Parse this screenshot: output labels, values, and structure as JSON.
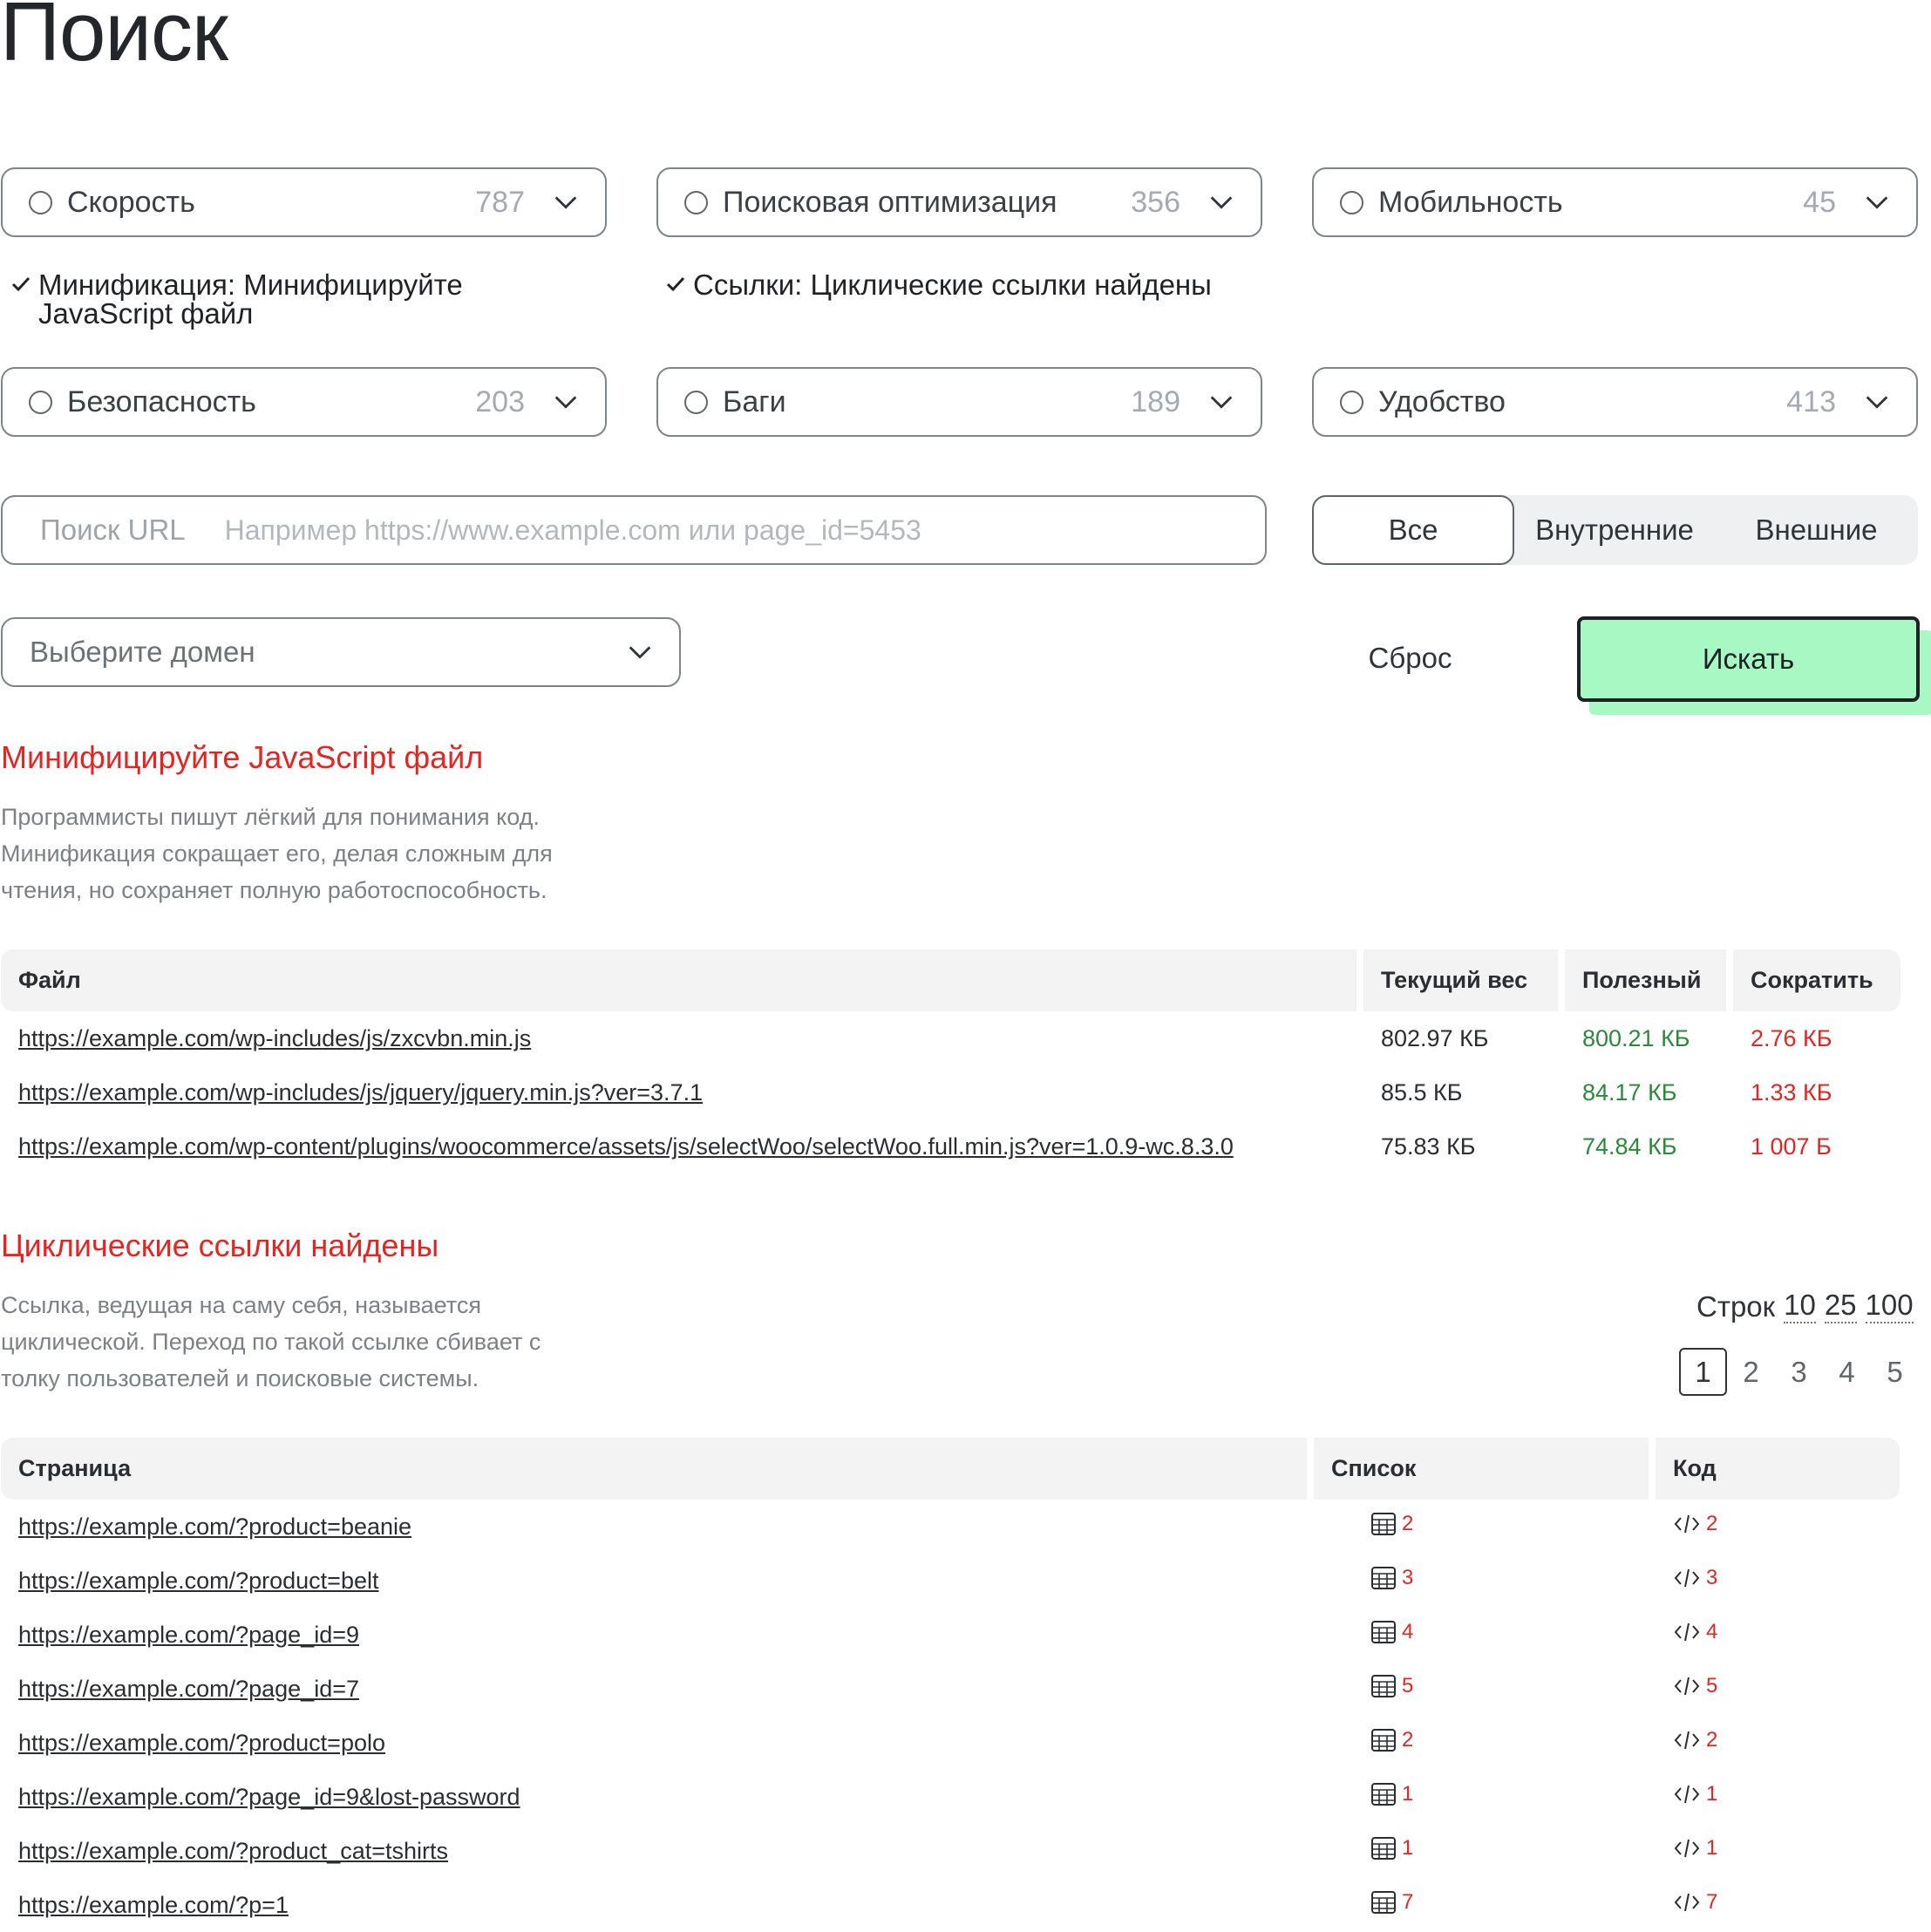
{
  "page": {
    "title": "Поиск"
  },
  "filters": [
    {
      "label": "Скорость",
      "count": "787"
    },
    {
      "label": "Поисковая оптимизация",
      "count": "356"
    },
    {
      "label": "Мобильность",
      "count": "45"
    },
    {
      "label": "Безопасность",
      "count": "203"
    },
    {
      "label": "Баги",
      "count": "189"
    },
    {
      "label": "Удобство",
      "count": "413"
    }
  ],
  "selected": [
    {
      "line1": "Минификация: Минифицируйте",
      "line2": "JavaScript файл"
    },
    {
      "line1": "Ссылки: Циклические ссылки найдены",
      "line2": ""
    }
  ],
  "url_search": {
    "label": "Поиск URL",
    "placeholder": "Например https://www.example.com или page_id=5453"
  },
  "link_type": {
    "options": [
      "Все",
      "Внутренние",
      "Внешние"
    ],
    "selected": "Все"
  },
  "domain_select": {
    "placeholder": "Выберите домен"
  },
  "actions": {
    "reset": "Сброс",
    "search": "Искать"
  },
  "colors": {
    "accent_red": "#e52521",
    "useful_green": "#2a8a3a",
    "search_button": "#a8f8c4"
  },
  "minify": {
    "title": "Минифицируйте JavaScript файл",
    "desc": [
      "Программисты пишут лёгкий для понимания код.",
      "Минификация сокращает его, делая сложным для",
      "чтения, но сохраняет полную работоспособность."
    ],
    "columns": [
      "Файл",
      "Текущий вес",
      "Полезный",
      "Сократить"
    ],
    "rows": [
      {
        "file": "https://example.com/wp-includes/js/zxcvbn.min.js",
        "weight": "802.97 КБ",
        "useful": "800.21 КБ",
        "reduce": "2.76 КБ"
      },
      {
        "file": "https://example.com/wp-includes/js/jquery/jquery.min.js?ver=3.7.1",
        "weight": "85.5 КБ",
        "useful": "84.17 КБ",
        "reduce": "1.33 КБ"
      },
      {
        "file": "https://example.com/wp-content/plugins/woocommerce/assets/js/selectWoo/selectWoo.full.min.js?ver=1.0.9-wc.8.3.0",
        "weight": "75.83 КБ",
        "useful": "74.84 КБ",
        "reduce": "1 007 Б"
      }
    ]
  },
  "cyclic": {
    "title": "Циклические ссылки найдены",
    "desc": [
      "Ссылка, ведущая на саму себя, называется",
      "циклической. Переход по такой ссылке сбивает с",
      "толку пользователей и поисковые системы."
    ],
    "rows_label": "Строк",
    "rows_options": [
      "10",
      "25",
      "100"
    ],
    "pages": [
      "1",
      "2",
      "3",
      "4",
      "5"
    ],
    "current_page": "1",
    "columns": [
      "Страница",
      "Список",
      "Код"
    ],
    "rows": [
      {
        "page": "https://example.com/?product=beanie",
        "list": "2",
        "code": "2"
      },
      {
        "page": "https://example.com/?product=belt",
        "list": "3",
        "code": "3"
      },
      {
        "page": "https://example.com/?page_id=9",
        "list": "4",
        "code": "4"
      },
      {
        "page": "https://example.com/?page_id=7",
        "list": "5",
        "code": "5"
      },
      {
        "page": "https://example.com/?product=polo",
        "list": "2",
        "code": "2"
      },
      {
        "page": "https://example.com/?page_id=9&lost-password",
        "list": "1",
        "code": "1"
      },
      {
        "page": "https://example.com/?product_cat=tshirts",
        "list": "1",
        "code": "1"
      },
      {
        "page": "https://example.com/?p=1",
        "list": "7",
        "code": "7"
      }
    ]
  }
}
